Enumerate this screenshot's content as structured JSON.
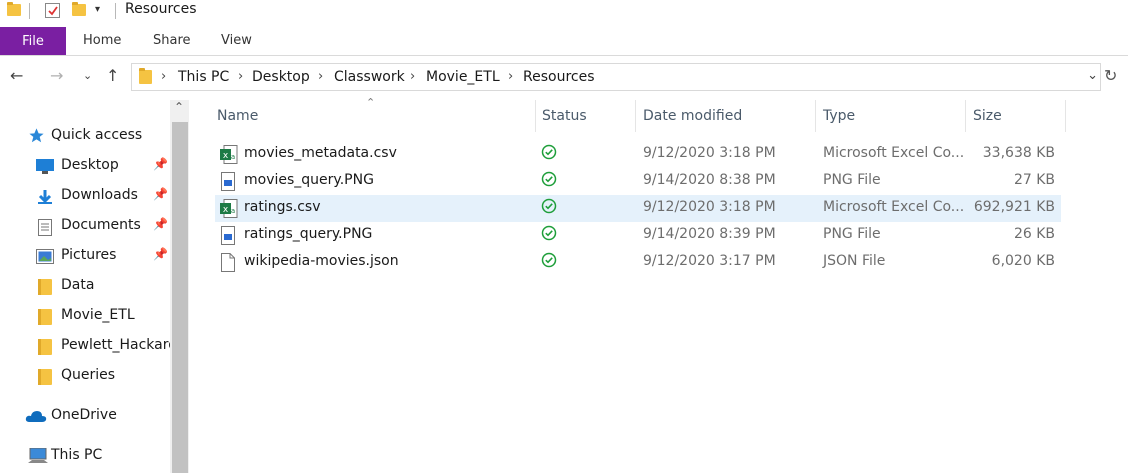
{
  "window": {
    "title": "Resources"
  },
  "ribbon": {
    "tabs": [
      "File",
      "Home",
      "Share",
      "View"
    ]
  },
  "address": {
    "crumbs": [
      "This PC",
      "Desktop",
      "Classwork",
      "Movie_ETL",
      "Resources"
    ]
  },
  "nav_pane": {
    "items": [
      {
        "label": "Quick access",
        "icon": "star-icon",
        "pinned": false
      },
      {
        "label": "Desktop",
        "icon": "desktop-icon",
        "pinned": true
      },
      {
        "label": "Downloads",
        "icon": "download-icon",
        "pinned": true
      },
      {
        "label": "Documents",
        "icon": "documents-icon",
        "pinned": true
      },
      {
        "label": "Pictures",
        "icon": "pictures-icon",
        "pinned": true
      },
      {
        "label": "Data",
        "icon": "folder-icon",
        "pinned": false
      },
      {
        "label": "Movie_ETL",
        "icon": "folder-icon",
        "pinned": false
      },
      {
        "label": "Pewlett_Hackard",
        "icon": "folder-icon",
        "pinned": false
      },
      {
        "label": "Queries",
        "icon": "folder-icon",
        "pinned": false
      },
      {
        "label": "OneDrive",
        "icon": "cloud-icon",
        "pinned": false
      },
      {
        "label": "This PC",
        "icon": "computer-icon",
        "pinned": false
      }
    ]
  },
  "columns": {
    "name": "Name",
    "status": "Status",
    "date": "Date modified",
    "type": "Type",
    "size": "Size"
  },
  "files": [
    {
      "name": "movies_metadata.csv",
      "icon": "excel-csv-icon",
      "date": "9/12/2020 3:18 PM",
      "type": "Microsoft Excel Co...",
      "size": "33,638 KB",
      "selected": false
    },
    {
      "name": "movies_query.PNG",
      "icon": "image-file-icon",
      "date": "9/14/2020 8:38 PM",
      "type": "PNG File",
      "size": "27 KB",
      "selected": false
    },
    {
      "name": "ratings.csv",
      "icon": "excel-csv-icon",
      "date": "9/12/2020 3:18 PM",
      "type": "Microsoft Excel Co...",
      "size": "692,921 KB",
      "selected": true
    },
    {
      "name": "ratings_query.PNG",
      "icon": "image-file-icon",
      "date": "9/14/2020 8:39 PM",
      "type": "PNG File",
      "size": "26 KB",
      "selected": false
    },
    {
      "name": "wikipedia-movies.json",
      "icon": "generic-file-icon",
      "date": "9/12/2020 3:17 PM",
      "type": "JSON File",
      "size": "6,020 KB",
      "selected": false
    }
  ],
  "colors": {
    "file_tab": "#7a1fa2",
    "selection": "#e5f1fb",
    "status_ok": "#1e9e3a",
    "folder": "#f5c342"
  }
}
